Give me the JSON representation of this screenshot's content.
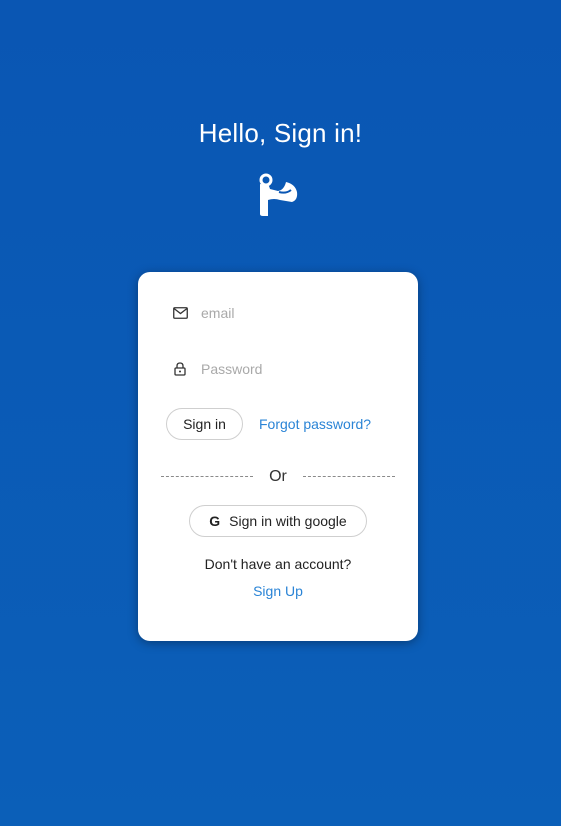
{
  "header": {
    "title": "Hello, Sign in!",
    "logo_icon": "flexed-arm-icon"
  },
  "form": {
    "email": {
      "placeholder": "email",
      "value": "",
      "icon": "mail-icon"
    },
    "password": {
      "placeholder": "Password",
      "value": "",
      "icon": "lock-icon"
    },
    "signin_label": "Sign in",
    "forgot_label": "Forgot password?",
    "divider_label": "Or",
    "google_icon": "G",
    "google_label": "Sign in with google",
    "no_account_text": "Don't have an account?",
    "signup_label": "Sign Up"
  },
  "colors": {
    "background": "#0a56b3",
    "link": "#2a84d6",
    "card": "#ffffff"
  }
}
